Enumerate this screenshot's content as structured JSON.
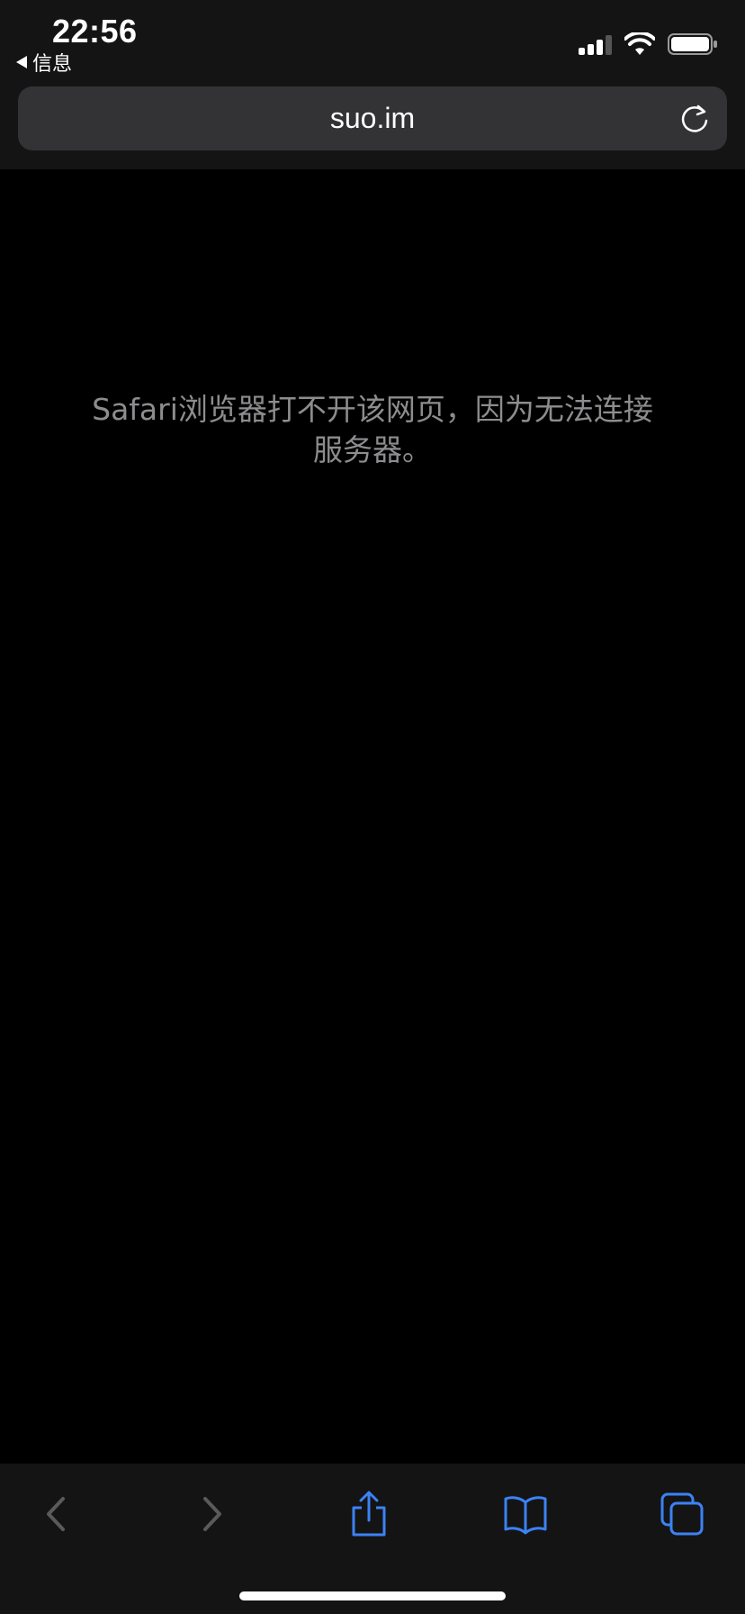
{
  "status_bar": {
    "time": "22:56",
    "back_app_label": "信息",
    "icons": [
      "cellular-signal-icon",
      "wifi-icon",
      "battery-icon"
    ]
  },
  "address_bar": {
    "url": "suo.im",
    "reload_icon": "reload-icon"
  },
  "content": {
    "error_message": "Safari浏览器打不开该网页，因为无法连接服务器。"
  },
  "toolbar": {
    "icons": [
      "back-icon",
      "forward-icon",
      "share-icon",
      "bookmarks-icon",
      "tabs-icon"
    ],
    "disabled_color": "#5a5a5c",
    "accent_color": "#3b82f6"
  }
}
